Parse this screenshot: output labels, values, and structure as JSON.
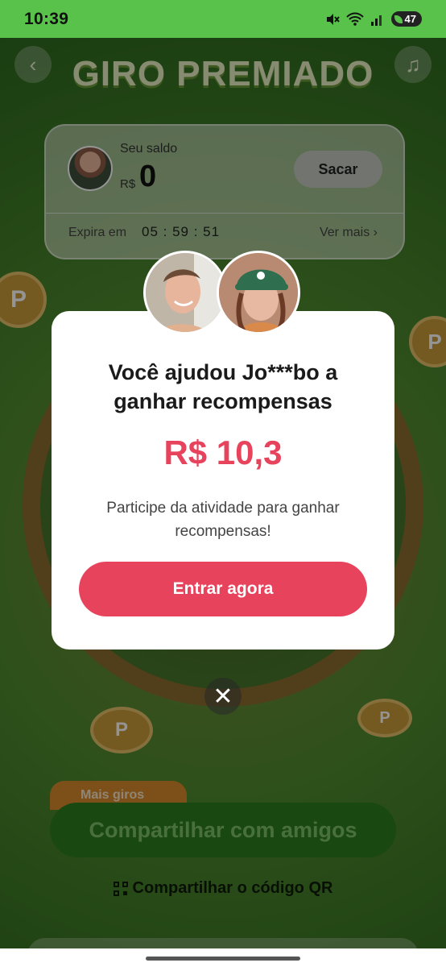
{
  "status_bar": {
    "time": "10:39",
    "battery": "47"
  },
  "app": {
    "title": "GIRO PREMIADO",
    "balance_card": {
      "label": "Seu saldo",
      "currency": "R$",
      "amount": "0",
      "withdraw_label": "Sacar",
      "expires_label": "Expira em",
      "timer": "05 : 59 : 51",
      "see_more_label": "Ver mais"
    },
    "more_spins_label": "Mais giros",
    "share_button_label": "Compartilhar com amigos",
    "qr_label": "Compartilhar o código QR"
  },
  "modal": {
    "title_line1": "Você ajudou Jo***bo a",
    "title_line2": "ganhar recompensas",
    "amount": "R$ 10,3",
    "description_line1": "Participe da atividade para ganhar",
    "description_line2": "recompensas!",
    "cta_label": "Entrar agora"
  },
  "colors": {
    "accent": "#e8435c",
    "status_bar": "#58c24a"
  },
  "icons": {
    "back": "back-icon",
    "music": "music-icon",
    "close": "close-icon",
    "qr": "qr-code-icon"
  }
}
